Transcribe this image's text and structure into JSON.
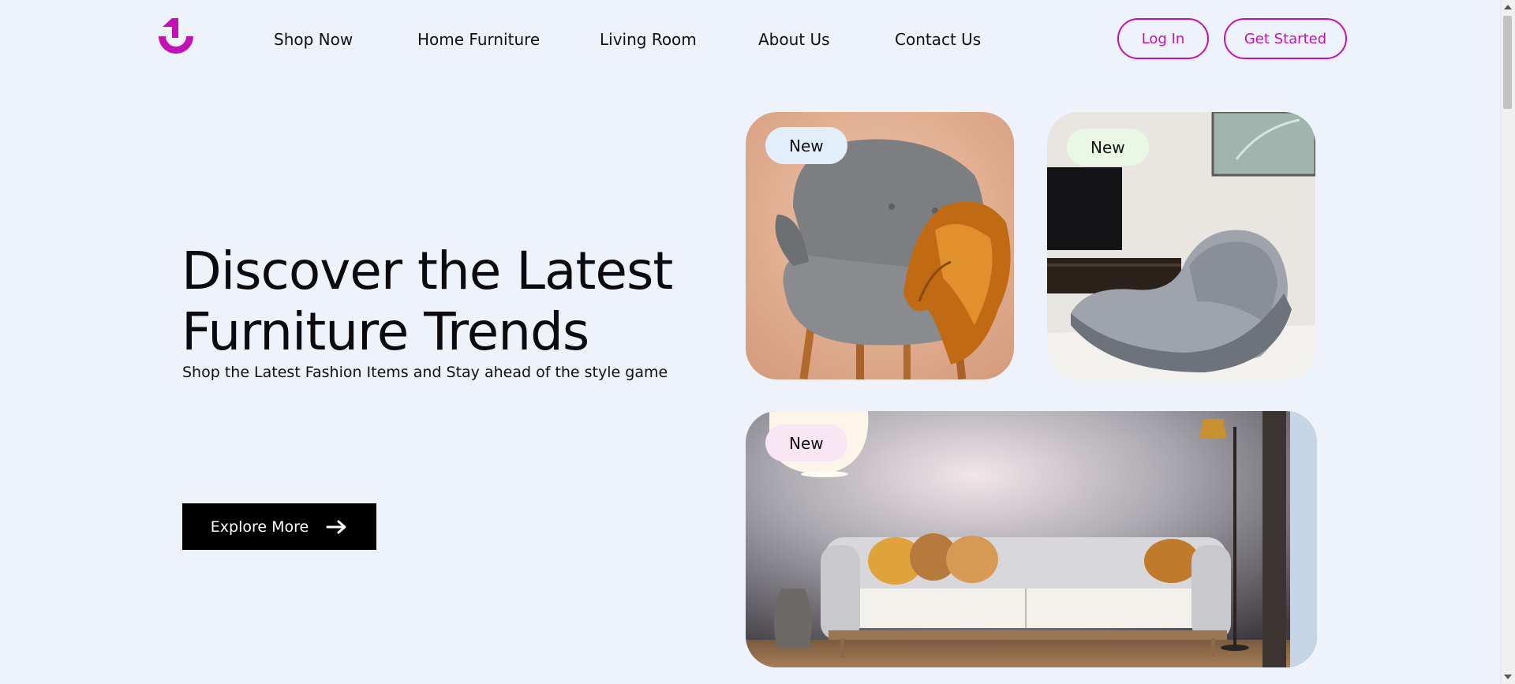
{
  "header": {
    "nav": [
      "Shop Now",
      "Home Furniture",
      "Living Room",
      "About Us",
      "Contact Us"
    ],
    "login_label": "Log In",
    "get_started_label": "Get Started"
  },
  "hero": {
    "title_line1": "Discover the Latest",
    "title_line2": "Furniture Trends",
    "subtitle": "Shop the Latest Fashion Items and Stay ahead of the style game",
    "cta_label": "Explore More",
    "cta_icon": "arrow-right-icon"
  },
  "products": [
    {
      "badge": "New",
      "scene": "grey armchair with fur throw"
    },
    {
      "badge": "New",
      "scene": "grey rocking lounge chair"
    },
    {
      "badge": "New",
      "scene": "grey sofa with cushions"
    }
  ],
  "colors": {
    "accent": "#c311b8",
    "background": "#eef2fb",
    "cta_background": "#000000",
    "badge_blue": "#e3eefb",
    "badge_green": "#e8f8e4",
    "badge_pink": "#f8e6f3"
  }
}
